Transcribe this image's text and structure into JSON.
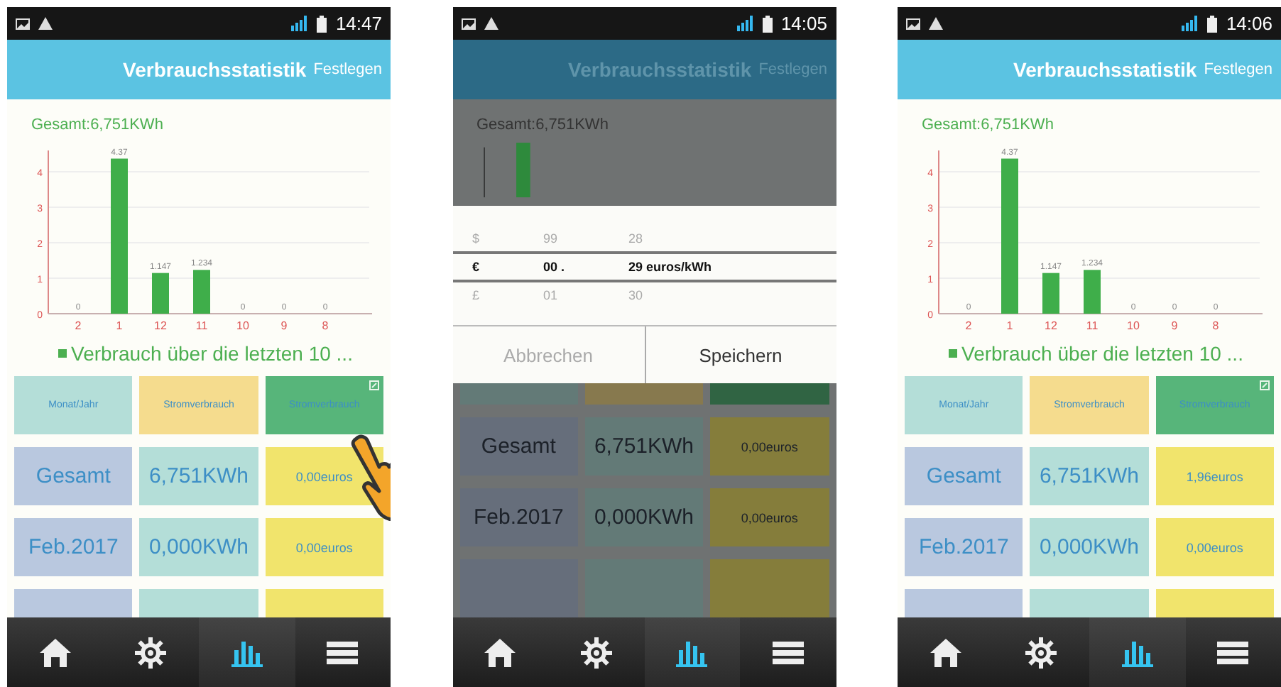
{
  "screens": [
    {
      "status_bar": {
        "time": "14:47"
      },
      "title": "Verbrauchsstatistik",
      "action": "Festlegen",
      "dimmed": false,
      "total": "Gesamt:6,751KWh",
      "touch_indicator": true,
      "chart_data": {
        "type": "bar",
        "categories": [
          "2",
          "1",
          "12",
          "11",
          "10",
          "9",
          "8"
        ],
        "values": [
          0,
          4.37,
          1.147,
          1.234,
          0,
          0,
          0
        ],
        "data_labels": true,
        "ylim": [
          0,
          4.6
        ],
        "yticks": [
          0,
          1,
          2,
          3,
          4
        ],
        "grid": true
      },
      "legend": "Verbrauch über die letzten 10 ...",
      "table": {
        "columns": [
          {
            "label": "Monat/Jahr",
            "selected": false
          },
          {
            "label": "Stromverbrauch",
            "selected": false
          },
          {
            "label": "Stromverbrauch",
            "selected": true
          }
        ],
        "rows": [
          [
            "Gesamt",
            "6,751KWh",
            "0,00euros"
          ],
          [
            "Feb.2017",
            "0,000KWh",
            "0,00euros"
          ]
        ]
      },
      "nav": [
        {
          "kind": "home",
          "selected": false
        },
        {
          "kind": "settings",
          "selected": false
        },
        {
          "kind": "statistics",
          "selected": true
        },
        {
          "kind": "menu",
          "selected": false
        }
      ]
    },
    {
      "status_bar": {
        "time": "14:05"
      },
      "title": "Verbrauchsstatistik",
      "action": "Festlegen",
      "dimmed": true,
      "total": "Gesamt:6,751KWh",
      "touch_indicator": false,
      "picker": {
        "rows": [
          {
            "cells": [
              "$",
              "99",
              "28"
            ],
            "selected": false
          },
          {
            "cells": [
              "€",
              "00 .",
              "29 euros/kWh"
            ],
            "selected": true
          },
          {
            "cells": [
              "£",
              "01",
              "30"
            ],
            "selected": false
          }
        ],
        "buttons": [
          {
            "label": "Abbrechen",
            "disabled": true
          },
          {
            "label": "Speichern",
            "disabled": false
          }
        ]
      },
      "table": {
        "columns": [
          {
            "selected": false
          },
          {
            "selected": false
          },
          {
            "selected": true
          }
        ],
        "rows": [
          [
            "Gesamt",
            "6,751KWh",
            "0,00euros"
          ],
          [
            "Feb.2017",
            "0,000KWh",
            "0,00euros"
          ]
        ]
      },
      "nav": [
        {
          "kind": "home",
          "selected": false
        },
        {
          "kind": "settings",
          "selected": false
        },
        {
          "kind": "statistics",
          "selected": true
        },
        {
          "kind": "menu",
          "selected": false
        }
      ]
    },
    {
      "status_bar": {
        "time": "14:06"
      },
      "title": "Verbrauchsstatistik",
      "action": "Festlegen",
      "dimmed": false,
      "total": "Gesamt:6,751KWh",
      "touch_indicator": false,
      "chart_data": {
        "type": "bar",
        "categories": [
          "2",
          "1",
          "12",
          "11",
          "10",
          "9",
          "8"
        ],
        "values": [
          0,
          4.37,
          1.147,
          1.234,
          0,
          0,
          0
        ],
        "data_labels": true,
        "ylim": [
          0,
          4.6
        ],
        "yticks": [
          0,
          1,
          2,
          3,
          4
        ],
        "grid": true
      },
      "legend": "Verbrauch über die letzten 10 ...",
      "table": {
        "columns": [
          {
            "label": "Monat/Jahr",
            "selected": false
          },
          {
            "label": "Stromverbrauch",
            "selected": false
          },
          {
            "label": "Stromverbrauch",
            "selected": true
          }
        ],
        "rows": [
          [
            "Gesamt",
            "6,751KWh",
            "1,96euros"
          ],
          [
            "Feb.2017",
            "0,000KWh",
            "0,00euros"
          ]
        ]
      },
      "nav": [
        {
          "kind": "home",
          "selected": false
        },
        {
          "kind": "settings",
          "selected": false
        },
        {
          "kind": "statistics",
          "selected": true
        },
        {
          "kind": "menu",
          "selected": false
        }
      ]
    }
  ]
}
